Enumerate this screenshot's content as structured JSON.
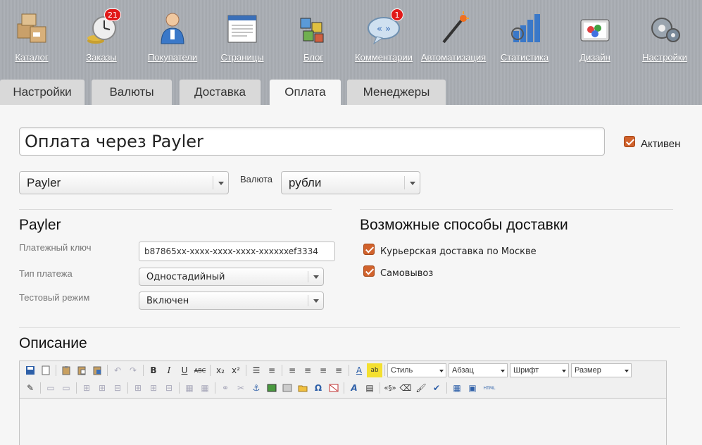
{
  "nav": {
    "items": [
      {
        "label": "Каталог",
        "icon": "catalog-boxes-icon"
      },
      {
        "label": "Заказы",
        "icon": "orders-clock-icon",
        "badge": "21"
      },
      {
        "label": "Покупатели",
        "icon": "customer-person-icon"
      },
      {
        "label": "Страницы",
        "icon": "pages-window-icon"
      },
      {
        "label": "Блог",
        "icon": "blog-blocks-icon"
      },
      {
        "label": "Комментарии",
        "icon": "comments-bubble-icon",
        "badge": "1"
      },
      {
        "label": "Автоматизация",
        "icon": "automation-wand-icon"
      },
      {
        "label": "Статистика",
        "icon": "statistics-chart-icon"
      },
      {
        "label": "Дизайн",
        "icon": "design-palette-icon"
      },
      {
        "label": "Настройки",
        "icon": "settings-gears-icon"
      }
    ]
  },
  "tabs": [
    {
      "label": "Настройки",
      "active": false
    },
    {
      "label": "Валюты",
      "active": false
    },
    {
      "label": "Доставка",
      "active": false
    },
    {
      "label": "Оплата",
      "active": true
    },
    {
      "label": "Менеджеры",
      "active": false
    }
  ],
  "form": {
    "title": "Оплата через Payler",
    "active_label": "Активен",
    "active_checked": true,
    "module_select": "Payler",
    "currency_label": "Валюта",
    "currency_select": "рубли"
  },
  "payler": {
    "heading": "Payler",
    "key_label": "Платежный ключ",
    "key_value": "b87865xx-xxxx-xxxx-xxxx-xxxxxxef3334",
    "type_label": "Тип платежа",
    "type_value": "Одностадийный",
    "test_label": "Тестовый режим",
    "test_value": "Включен"
  },
  "delivery": {
    "heading": "Возможные способы доставки",
    "options": [
      {
        "label": "Курьерская доставка по Москве",
        "checked": true
      },
      {
        "label": "Самовывоз",
        "checked": true
      }
    ]
  },
  "description": {
    "heading": "Описание"
  },
  "editor": {
    "style_select": "Стиль",
    "paragraph_select": "Абзац",
    "font_select": "Шрифт",
    "size_select": "Размер",
    "html_label": "HTML",
    "bold": "B",
    "italic": "I",
    "underline": "U",
    "strike": "ABC",
    "subscript": "x₂",
    "superscript": "x²",
    "omega": "Ω",
    "section": "«§»"
  },
  "colors": {
    "accent": "#d1622c",
    "nav_bg": "#a9adb3",
    "badge": "#e11919"
  }
}
